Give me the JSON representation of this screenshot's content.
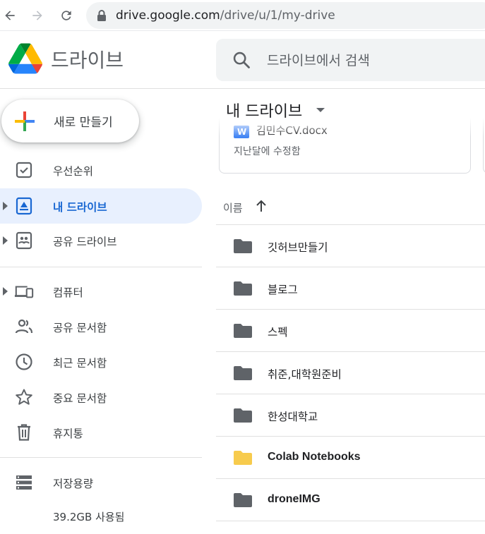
{
  "browser": {
    "url_host": "drive.google.com",
    "url_path": "/drive/u/1/my-drive"
  },
  "header": {
    "app_title": "드라이브",
    "search_placeholder": "드라이브에서 검색"
  },
  "new_button": {
    "label": "새로 만들기"
  },
  "sidebar": {
    "items": [
      {
        "label": "우선순위",
        "icon": "priority-check-icon"
      },
      {
        "label": "내 드라이브",
        "icon": "my-drive-icon",
        "active": true
      },
      {
        "label": "공유 드라이브",
        "icon": "shared-drive-icon"
      },
      {
        "label": "컴퓨터",
        "icon": "computers-icon"
      },
      {
        "label": "공유 문서함",
        "icon": "shared-with-me-icon"
      },
      {
        "label": "최근 문서함",
        "icon": "clock-icon"
      },
      {
        "label": "중요 문서함",
        "icon": "star-icon"
      },
      {
        "label": "휴지통",
        "icon": "trash-icon"
      },
      {
        "label": "저장용량",
        "icon": "storage-icon"
      }
    ],
    "storage_used": "39.2GB 사용됨"
  },
  "main": {
    "title": "내 드라이브",
    "suggested_card": {
      "name": "김민수CV.docx",
      "modified": "지난달에 수정함"
    },
    "column_name": "이름",
    "files": [
      {
        "name": "깃허브만들기",
        "color": "#5f6368"
      },
      {
        "name": "블로그",
        "color": "#5f6368"
      },
      {
        "name": "스펙",
        "color": "#5f6368"
      },
      {
        "name": "취준,대학원준비",
        "color": "#5f6368"
      },
      {
        "name": "한성대학교",
        "color": "#5f6368"
      },
      {
        "name": "Colab Notebooks",
        "color": "#f7cb4d"
      },
      {
        "name": "droneIMG",
        "color": "#5f6368"
      }
    ]
  },
  "colors": {
    "accent": "#1967d2",
    "active_bg": "#e8f0fe"
  }
}
